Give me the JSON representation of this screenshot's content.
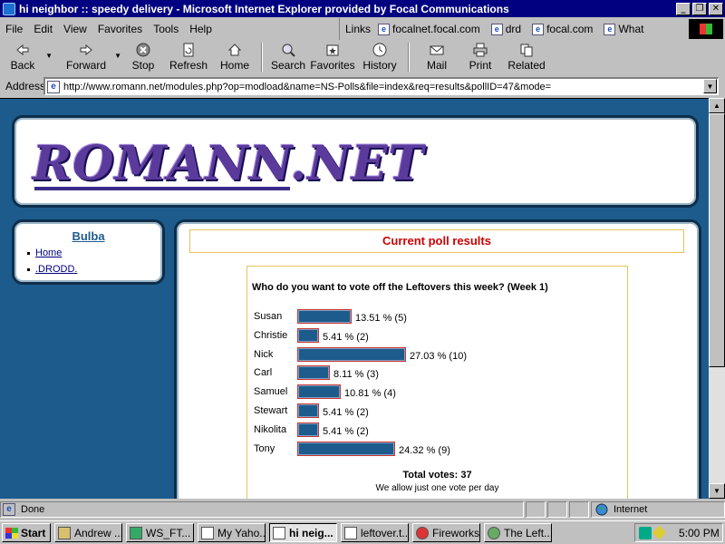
{
  "window": {
    "title": "hi neighbor :: speedy delivery - Microsoft Internet Explorer provided by Focal Communications",
    "controls": [
      "_",
      "❐",
      "✕"
    ]
  },
  "menubar": {
    "items": [
      {
        "label": "File"
      },
      {
        "label": "Edit"
      },
      {
        "label": "View"
      },
      {
        "label": "Favorites"
      },
      {
        "label": "Tools"
      },
      {
        "label": "Help"
      }
    ],
    "links_label": "Links",
    "links": [
      {
        "label": "focalnet.focal.com"
      },
      {
        "label": "drd"
      },
      {
        "label": "focal.com"
      },
      {
        "label": "What"
      }
    ]
  },
  "toolbar": {
    "back": "Back",
    "forward": "Forward",
    "stop": "Stop",
    "refresh": "Refresh",
    "home": "Home",
    "search": "Search",
    "favorites": "Favorites",
    "history": "History",
    "mail": "Mail",
    "print": "Print",
    "related": "Related"
  },
  "address": {
    "label": "Address",
    "url": "http://www.romann.net/modules.php?op=modload&name=NS-Polls&file=index&req=results&pollID=47&mode="
  },
  "site": {
    "logo": "ROMANN.NET",
    "side_title": "Bulba",
    "side_items": [
      {
        "label": "Home"
      },
      {
        "label": ".DRODD."
      }
    ],
    "results_heading": "Current poll results"
  },
  "poll": {
    "question": "Who do you want to vote off the Leftovers this week? (Week 1)",
    "rows": [
      {
        "name": "Susan",
        "percent_text": "13.51 % (5)"
      },
      {
        "name": "Christie",
        "percent_text": "5.41 % (2)"
      },
      {
        "name": "Nick",
        "percent_text": "27.03 % (10)"
      },
      {
        "name": "Carl",
        "percent_text": "8.11 % (3)"
      },
      {
        "name": "Samuel",
        "percent_text": "10.81 % (4)"
      },
      {
        "name": "Stewart",
        "percent_text": "5.41 % (2)"
      },
      {
        "name": "Nikolita",
        "percent_text": "5.41 % (2)"
      },
      {
        "name": "Tony",
        "percent_text": "24.32 % (9)"
      }
    ],
    "total": "Total votes: 37",
    "note": "We allow just one vote per day"
  },
  "chart_data": {
    "type": "bar",
    "title": "Who do you want to vote off the Leftovers this week? (Week 1)",
    "categories": [
      "Susan",
      "Christie",
      "Nick",
      "Carl",
      "Samuel",
      "Stewart",
      "Nikolita",
      "Tony"
    ],
    "values": [
      13.51,
      5.41,
      27.03,
      8.11,
      10.81,
      5.41,
      5.41,
      24.32
    ],
    "counts": [
      5,
      2,
      10,
      3,
      4,
      2,
      2,
      9
    ],
    "orientation": "horizontal",
    "bar_color": "#1d5b8c",
    "bar_border_color": "#cc3333"
  },
  "statusbar": {
    "status": "Done",
    "zone": "Internet"
  },
  "taskbar": {
    "start": "Start",
    "tasks": [
      {
        "label": "Andrew ...",
        "active": false
      },
      {
        "label": "WS_FT...",
        "active": false
      },
      {
        "label": "My Yaho...",
        "active": false
      },
      {
        "label": "hi neig...",
        "active": true
      },
      {
        "label": "leftover.t...",
        "active": false
      },
      {
        "label": "Fireworks",
        "active": false
      },
      {
        "label": "The Left...",
        "active": false
      }
    ],
    "clock": "5:00 PM"
  },
  "colors": {
    "title_bar": "#000080",
    "page_bg": "#1d5b8c",
    "heading_red": "#cc0000",
    "box_border": "#e6c45a"
  }
}
